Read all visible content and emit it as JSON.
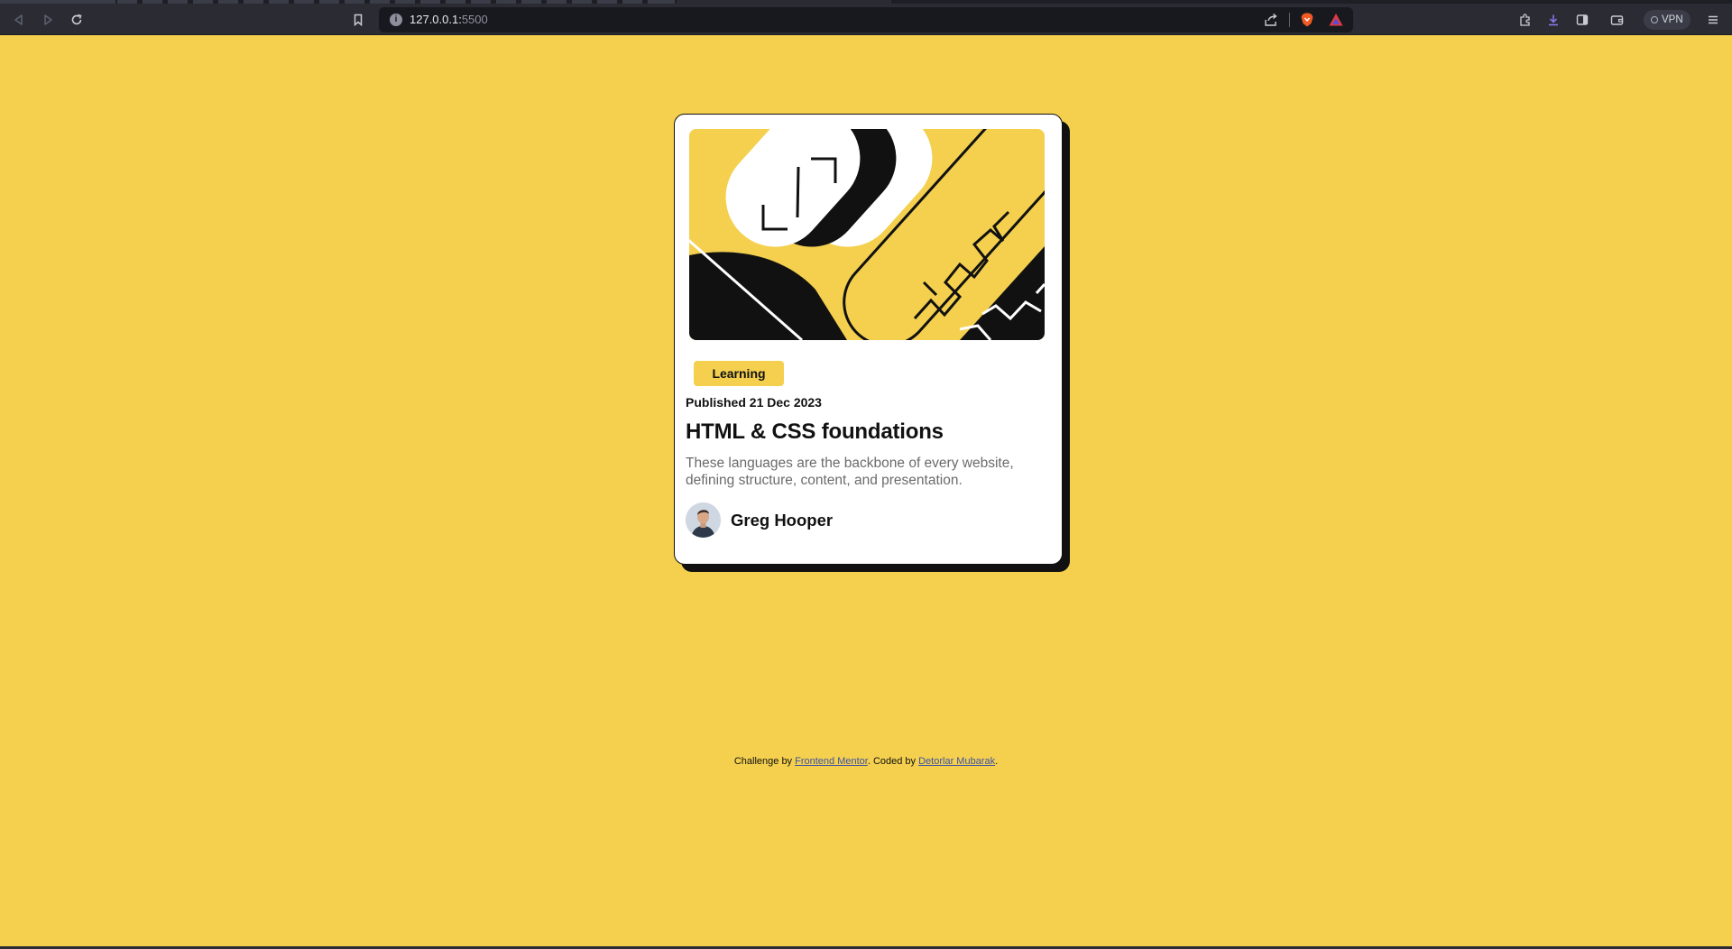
{
  "browser": {
    "url_host": "127.0.0.1:",
    "url_port": "5500",
    "vpn_label": "VPN",
    "icons": [
      "back-icon",
      "forward-icon",
      "reload-icon",
      "bookmark-icon",
      "site-info-icon",
      "share-icon",
      "brave-shields-icon",
      "brave-rewards-icon",
      "extensions-icon",
      "download-icon",
      "sidebar-icon",
      "wallet-icon",
      "menu-icon"
    ]
  },
  "card": {
    "tag": "Learning",
    "published": "Published 21 Dec 2023",
    "title": "HTML & CSS foundations",
    "description": "These languages are the backbone of every website, defining structure, content, and presentation.",
    "author": "Greg Hooper"
  },
  "attribution": {
    "prefix": "Challenge by ",
    "link1": "Frontend Mentor",
    "middle": ". Coded by ",
    "link2": "Detorlar Mubarak",
    "suffix": "."
  },
  "colors": {
    "background": "#f4d04e",
    "card": "#ffffff",
    "ink": "#111111",
    "muted_text": "#6b6b6b"
  }
}
